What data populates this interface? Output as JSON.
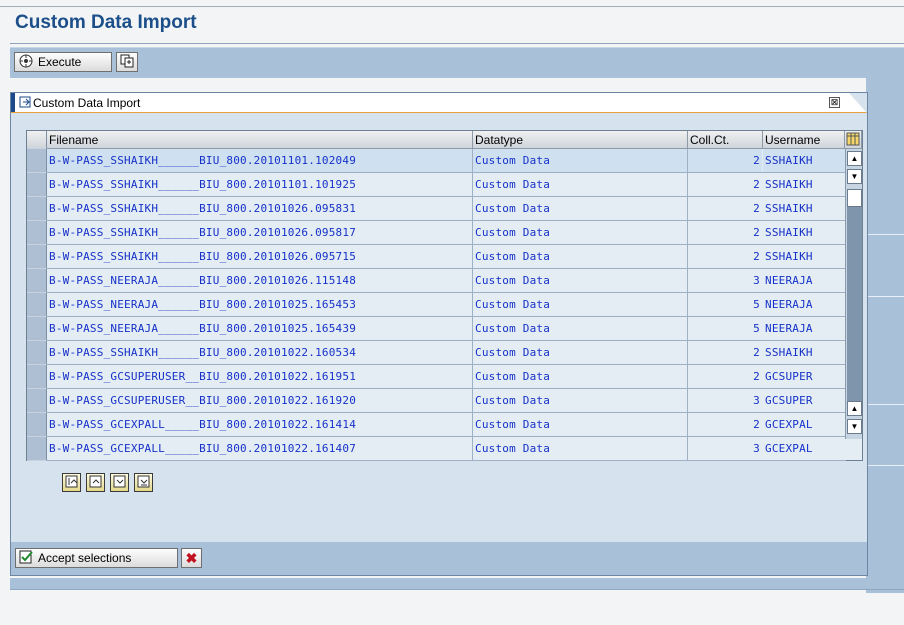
{
  "page": {
    "title": "Custom Data Import"
  },
  "toolbar": {
    "execute_label": "Execute",
    "execute_icon": "execute-icon",
    "variant_icon": "get-variant-icon"
  },
  "dialog": {
    "title": "Custom Data Import",
    "close_symbol": "⊠",
    "columns": [
      "Filename",
      "Datatype",
      "Coll.Ct.",
      "Username"
    ],
    "rows": [
      {
        "filename": "B-W-PASS_SSHAIKH______BIU_800.20101101.102049",
        "datatype": "Custom Data",
        "coll_ct": "2",
        "username": "SSHAIKH"
      },
      {
        "filename": "B-W-PASS_SSHAIKH______BIU_800.20101101.101925",
        "datatype": "Custom Data",
        "coll_ct": "2",
        "username": "SSHAIKH"
      },
      {
        "filename": "B-W-PASS_SSHAIKH______BIU_800.20101026.095831",
        "datatype": "Custom Data",
        "coll_ct": "2",
        "username": "SSHAIKH"
      },
      {
        "filename": "B-W-PASS_SSHAIKH______BIU_800.20101026.095817",
        "datatype": "Custom Data",
        "coll_ct": "2",
        "username": "SSHAIKH"
      },
      {
        "filename": "B-W-PASS_SSHAIKH______BIU_800.20101026.095715",
        "datatype": "Custom Data",
        "coll_ct": "2",
        "username": "SSHAIKH"
      },
      {
        "filename": "B-W-PASS_NEERAJA______BIU_800.20101026.115148",
        "datatype": "Custom Data",
        "coll_ct": "3",
        "username": "NEERAJA"
      },
      {
        "filename": "B-W-PASS_NEERAJA______BIU_800.20101025.165453",
        "datatype": "Custom Data",
        "coll_ct": "5",
        "username": "NEERAJA"
      },
      {
        "filename": "B-W-PASS_NEERAJA______BIU_800.20101025.165439",
        "datatype": "Custom Data",
        "coll_ct": "5",
        "username": "NEERAJA"
      },
      {
        "filename": "B-W-PASS_SSHAIKH______BIU_800.20101022.160534",
        "datatype": "Custom Data",
        "coll_ct": "2",
        "username": "SSHAIKH"
      },
      {
        "filename": "B-W-PASS_GCSUPERUSER__BIU_800.20101022.161951",
        "datatype": "Custom Data",
        "coll_ct": "2",
        "username": "GCSUPER"
      },
      {
        "filename": "B-W-PASS_GCSUPERUSER__BIU_800.20101022.161920",
        "datatype": "Custom Data",
        "coll_ct": "3",
        "username": "GCSUPER"
      },
      {
        "filename": "B-W-PASS_GCEXPALL_____BIU_800.20101022.161414",
        "datatype": "Custom Data",
        "coll_ct": "2",
        "username": "GCEXPAL"
      },
      {
        "filename": "B-W-PASS_GCEXPALL_____BIU_800.20101022.161407",
        "datatype": "Custom Data",
        "coll_ct": "3",
        "username": "GCEXPAL"
      }
    ],
    "nav_icons": [
      "first-page-icon",
      "previous-page-icon",
      "next-page-icon",
      "last-page-icon"
    ],
    "accept_label": "Accept selections",
    "accept_icon": "accept-icon",
    "cancel_icon": "cancel-icon",
    "colors": {
      "accent": "#1c4f8a",
      "toolbar": "#a9c1d8",
      "cell_text": "#1532c8",
      "cancel": "#c1121f"
    }
  }
}
